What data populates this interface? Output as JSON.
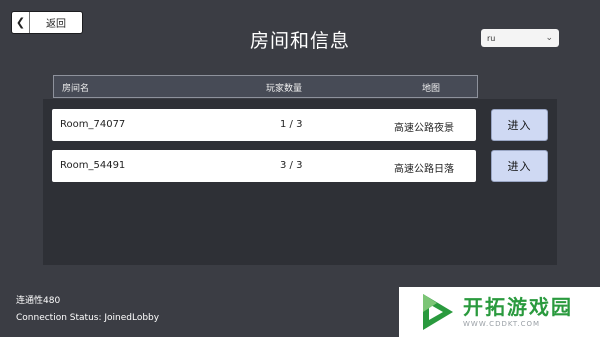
{
  "header": {
    "back_label": "返回",
    "back_icon": "chevron-left",
    "title": "房间和信息",
    "language": "ru"
  },
  "table": {
    "columns": [
      "房间名",
      "玩家数量",
      "地图"
    ],
    "rows": [
      {
        "name": "Room_74077",
        "players": "1 / 3",
        "map": "高速公路夜景",
        "action": "进入"
      },
      {
        "name": "Room_54491",
        "players": "3 / 3",
        "map": "高速公路日落",
        "action": "进入"
      }
    ]
  },
  "status": {
    "line1": "连通性480",
    "line2": "Connection Status: JoinedLobby"
  },
  "watermark": {
    "title": "开拓游戏园",
    "url": "WWW.CDDKT.COM"
  },
  "colors": {
    "background": "#3b3d44",
    "panel": "#2e3036",
    "join_button": "#cfd9f3",
    "watermark_green": "#2a9a3e"
  }
}
